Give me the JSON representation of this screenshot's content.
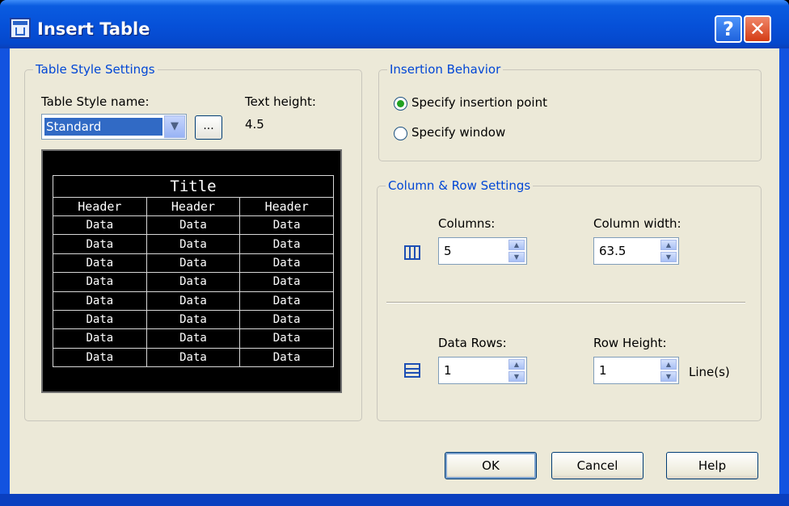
{
  "window": {
    "title": "Insert Table",
    "help_button": "?",
    "close_button": "✕"
  },
  "table_style": {
    "group_label": "Table Style Settings",
    "style_name_label": "Table Style name:",
    "style_name_value": "Standard",
    "text_height_label": "Text height:",
    "text_height_value": "4.5",
    "browse_button": "...",
    "preview": {
      "title": "Title",
      "headers": [
        "Header",
        "Header",
        "Header"
      ],
      "rows": [
        [
          "Data",
          "Data",
          "Data"
        ],
        [
          "Data",
          "Data",
          "Data"
        ],
        [
          "Data",
          "Data",
          "Data"
        ],
        [
          "Data",
          "Data",
          "Data"
        ],
        [
          "Data",
          "Data",
          "Data"
        ],
        [
          "Data",
          "Data",
          "Data"
        ],
        [
          "Data",
          "Data",
          "Data"
        ],
        [
          "Data",
          "Data",
          "Data"
        ]
      ]
    }
  },
  "insertion": {
    "group_label": "Insertion Behavior",
    "option_point": "Specify insertion point",
    "option_window": "Specify window",
    "selected": "point"
  },
  "colrow": {
    "group_label": "Column & Row Settings",
    "columns_label": "Columns:",
    "columns_value": "5",
    "column_width_label": "Column width:",
    "column_width_value": "63.5",
    "data_rows_label": "Data Rows:",
    "data_rows_value": "1",
    "row_height_label": "Row Height:",
    "row_height_value": "1",
    "row_height_unit": "Line(s)"
  },
  "buttons": {
    "ok": "OK",
    "cancel": "Cancel",
    "help": "Help"
  }
}
